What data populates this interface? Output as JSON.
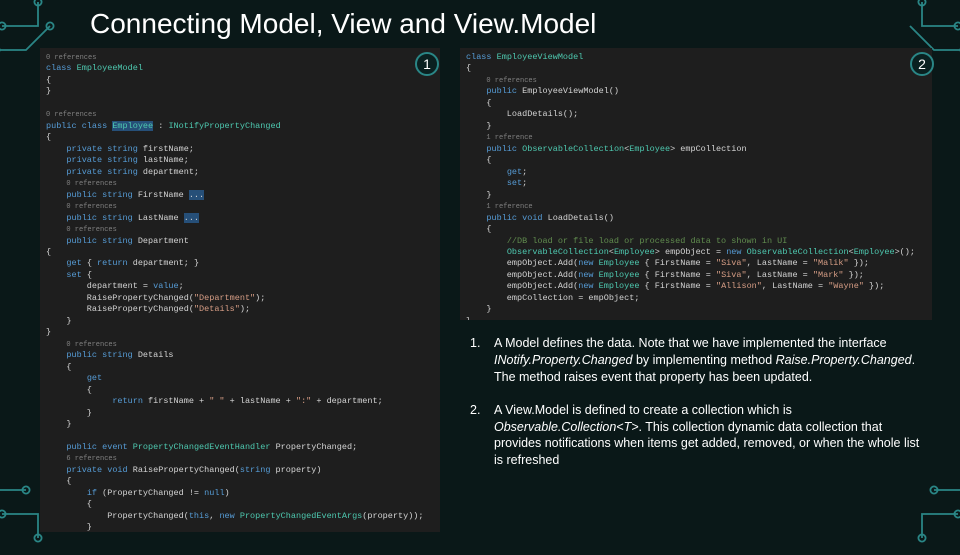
{
  "title": "Connecting Model, View and View.Model",
  "badges": {
    "one": "1",
    "two": "2"
  },
  "notes": [
    {
      "num": "1.",
      "text": "A Model defines the data. Note that we have implemented the interface <em>INotify.Property.Changed</em> by implementing method <em>Raise.Property.Changed</em>. The method raises event that property has been updated."
    },
    {
      "num": "2.",
      "text": " A View.Model is defined to create a collection which is <em>Observable.Collection&lt;T&gt;</em>. This collection dynamic data collection that provides notifications when items get added, removed, or when the whole list is refreshed"
    }
  ],
  "code_left": "<span class='ref'>0 references</span>\n<span class='kw'>class</span> <span class='cls'>EmployeeModel</span>\n{\n}\n\n<span class='ref'>0 references</span>\n<span class='kw'>public class</span> <span class='cls hl'>Employee</span> : <span class='cls'>INotifyPropertyChanged</span>\n{\n    <span class='kw'>private string</span> firstName;\n    <span class='kw'>private string</span> lastName;\n    <span class='kw'>private string</span> department;\n    <span class='ref'>0 references</span>\n    <span class='kw'>public string</span> FirstName <span class='hl'>...</span>\n    <span class='ref'>0 references</span>\n    <span class='kw'>public string</span> LastName <span class='hl'>...</span>\n    <span class='ref'>0 references</span>\n    <span class='kw'>public string</span> Department\n{\n    <span class='kw'>get</span> { <span class='kw'>return</span> department; }\n    <span class='kw'>set</span> {\n        department = <span class='kw'>value</span>;\n        RaisePropertyChanged(<span class='str'>\"Department\"</span>);\n        RaisePropertyChanged(<span class='str'>\"Details\"</span>);\n    }\n}\n    <span class='ref'>0 references</span>\n    <span class='kw'>public string</span> Details\n    {\n        <span class='kw'>get</span>\n        {\n             <span class='kw'>return</span> firstName + <span class='str'>\" \"</span> + lastName + <span class='str'>\":\"</span> + department;\n        }\n    }\n\n    <span class='kw'>public event</span> <span class='cls'>PropertyChangedEventHandler</span> PropertyChanged;\n    <span class='ref'>6 references</span>\n    <span class='kw'>private void</span> RaisePropertyChanged(<span class='kw'>string</span> property)\n    {\n        <span class='kw'>if</span> (PropertyChanged != <span class='kw'>null</span>)\n        {\n            PropertyChanged(<span class='kw'>this</span>, <span class='kw'>new</span> <span class='cls'>PropertyChangedEventArgs</span>(property));\n        }\n    }",
  "code_right": "<span class='kw'>class</span> <span class='cls'>EmployeeViewModel</span>\n{\n    <span class='ref'>0 references</span>\n    <span class='kw'>public</span> EmployeeViewModel()\n    {\n        LoadDetails();\n    }\n    <span class='ref'>1 reference</span>\n    <span class='kw'>public</span> <span class='cls'>ObservableCollection</span>&lt;<span class='cls'>Employee</span>&gt; empCollection\n    {\n        <span class='kw'>get</span>;\n        <span class='kw'>set</span>;\n    }\n    <span class='ref'>1 reference</span>\n    <span class='kw'>public void</span> LoadDetails()\n    {\n        <span class='cmt'>//DB load or file load or processed data to shown in UI</span>\n        <span class='cls'>ObservableCollection</span>&lt;<span class='cls'>Employee</span>&gt; empObject = <span class='kw'>new</span> <span class='cls'>ObservableCollection</span>&lt;<span class='cls'>Employee</span>&gt;();\n        empObject.Add(<span class='kw'>new</span> <span class='cls'>Employee</span> { FirstName = <span class='str'>\"Siva\"</span>, LastName = <span class='str'>\"Malik\"</span> });\n        empObject.Add(<span class='kw'>new</span> <span class='cls'>Employee</span> { FirstName = <span class='str'>\"Siva\"</span>, LastName = <span class='str'>\"Mark\"</span> });\n        empObject.Add(<span class='kw'>new</span> <span class='cls'>Employee</span> { FirstName = <span class='str'>\"Allison\"</span>, LastName = <span class='str'>\"Wayne\"</span> });\n        empCollection = empObject;\n    }\n}"
}
